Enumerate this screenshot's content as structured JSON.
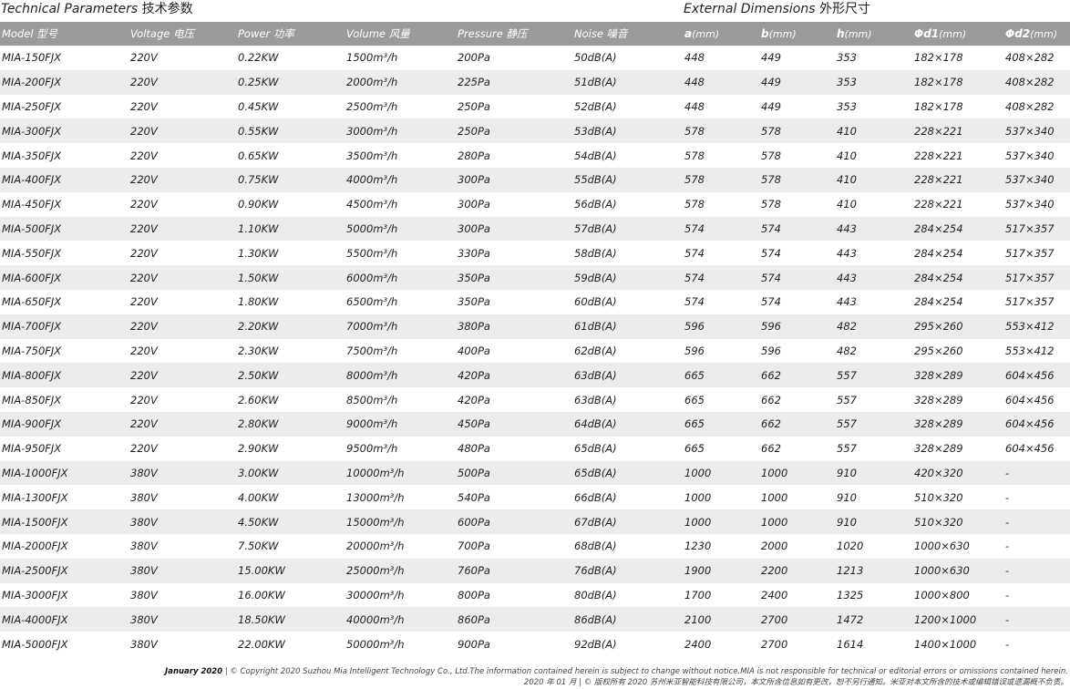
{
  "titles": {
    "technical": "Technical Parameters",
    "technical_cn": "技术参数",
    "external": "External Dimensions",
    "external_cn": "外形尺寸"
  },
  "headers": {
    "model": "Model 型号",
    "voltage": "Voltage 电压",
    "power": "Power 功率",
    "volume": "Volume 风量",
    "pressure": "Pressure 静压",
    "noise": "Noise 噪音",
    "a": "a",
    "a_unit": "(mm)",
    "b": "b",
    "b_unit": "(mm)",
    "h": "h",
    "h_unit": "(mm)",
    "d1": "Φd1",
    "d1_unit": "(mm)",
    "d2": "Φd2",
    "d2_unit": "(mm)"
  },
  "rows": [
    [
      "MIA-150FJX",
      "220V",
      "0.22KW",
      "1500m³/h",
      "200Pa",
      "50dB(A)",
      "448",
      "449",
      "353",
      "182×178",
      "408×282"
    ],
    [
      "MIA-200FJX",
      "220V",
      "0.25KW",
      "2000m³/h",
      "225Pa",
      "51dB(A)",
      "448",
      "449",
      "353",
      "182×178",
      "408×282"
    ],
    [
      "MIA-250FJX",
      "220V",
      "0.45KW",
      "2500m³/h",
      "250Pa",
      "52dB(A)",
      "448",
      "449",
      "353",
      "182×178",
      "408×282"
    ],
    [
      "MIA-300FJX",
      "220V",
      "0.55KW",
      "3000m³/h",
      "250Pa",
      "53dB(A)",
      "578",
      "578",
      "410",
      "228×221",
      "537×340"
    ],
    [
      "MIA-350FJX",
      "220V",
      "0.65KW",
      "3500m³/h",
      "280Pa",
      "54dB(A)",
      "578",
      "578",
      "410",
      "228×221",
      "537×340"
    ],
    [
      "MIA-400FJX",
      "220V",
      "0.75KW",
      "4000m³/h",
      "300Pa",
      "55dB(A)",
      "578",
      "578",
      "410",
      "228×221",
      "537×340"
    ],
    [
      "MIA-450FJX",
      "220V",
      "0.90KW",
      "4500m³/h",
      "300Pa",
      "56dB(A)",
      "578",
      "578",
      "410",
      "228×221",
      "537×340"
    ],
    [
      "MIA-500FJX",
      "220V",
      "1.10KW",
      "5000m³/h",
      "300Pa",
      "57dB(A)",
      "574",
      "574",
      "443",
      "284×254",
      "517×357"
    ],
    [
      "MIA-550FJX",
      "220V",
      "1.30KW",
      "5500m³/h",
      "330Pa",
      "58dB(A)",
      "574",
      "574",
      "443",
      "284×254",
      "517×357"
    ],
    [
      "MIA-600FJX",
      "220V",
      "1.50KW",
      "6000m³/h",
      "350Pa",
      "59dB(A)",
      "574",
      "574",
      "443",
      "284×254",
      "517×357"
    ],
    [
      "MIA-650FJX",
      "220V",
      "1.80KW",
      "6500m³/h",
      "350Pa",
      "60dB(A)",
      "574",
      "574",
      "443",
      "284×254",
      "517×357"
    ],
    [
      "MIA-700FJX",
      "220V",
      "2.20KW",
      "7000m³/h",
      "380Pa",
      "61dB(A)",
      "596",
      "596",
      "482",
      "295×260",
      "553×412"
    ],
    [
      "MIA-750FJX",
      "220V",
      "2.30KW",
      "7500m³/h",
      "400Pa",
      "62dB(A)",
      "596",
      "596",
      "482",
      "295×260",
      "553×412"
    ],
    [
      "MIA-800FJX",
      "220V",
      "2.50KW",
      "8000m³/h",
      "420Pa",
      "63dB(A)",
      "665",
      "662",
      "557",
      "328×289",
      "604×456"
    ],
    [
      "MIA-850FJX",
      "220V",
      "2.60KW",
      "8500m³/h",
      "420Pa",
      "63dB(A)",
      "665",
      "662",
      "557",
      "328×289",
      "604×456"
    ],
    [
      "MIA-900FJX",
      "220V",
      "2.80KW",
      "9000m³/h",
      "450Pa",
      "64dB(A)",
      "665",
      "662",
      "557",
      "328×289",
      "604×456"
    ],
    [
      "MIA-950FJX",
      "220V",
      "2.90KW",
      "9500m³/h",
      "480Pa",
      "65dB(A)",
      "665",
      "662",
      "557",
      "328×289",
      "604×456"
    ],
    [
      "MIA-1000FJX",
      "380V",
      "3.00KW",
      "10000m³/h",
      "500Pa",
      "65dB(A)",
      "1000",
      "1000",
      "910",
      "420×320",
      "-"
    ],
    [
      "MIA-1300FJX",
      "380V",
      "4.00KW",
      "13000m³/h",
      "540Pa",
      "66dB(A)",
      "1000",
      "1000",
      "910",
      "510×320",
      "-"
    ],
    [
      "MIA-1500FJX",
      "380V",
      "4.50KW",
      "15000m³/h",
      "600Pa",
      "67dB(A)",
      "1000",
      "1000",
      "910",
      "510×320",
      "-"
    ],
    [
      "MIA-2000FJX",
      "380V",
      "7.50KW",
      "20000m³/h",
      "700Pa",
      "68dB(A)",
      "1230",
      "2000",
      "1020",
      "1000×630",
      "-"
    ],
    [
      "MIA-2500FJX",
      "380V",
      "15.00KW",
      "25000m³/h",
      "760Pa",
      "76dB(A)",
      "1900",
      "2200",
      "1213",
      "1000×630",
      "-"
    ],
    [
      "MIA-3000FJX",
      "380V",
      "16.00KW",
      "30000m³/h",
      "800Pa",
      "80dB(A)",
      "1700",
      "2400",
      "1325",
      "1000×800",
      "-"
    ],
    [
      "MIA-4000FJX",
      "380V",
      "18.50KW",
      "40000m³/h",
      "860Pa",
      "86dB(A)",
      "2100",
      "2700",
      "1472",
      "1200×1000",
      "-"
    ],
    [
      "MIA-5000FJX",
      "380V",
      "22.00KW",
      "50000m³/h",
      "900Pa",
      "92dB(A)",
      "2400",
      "2700",
      "1614",
      "1400×1000",
      "-"
    ]
  ],
  "footer": {
    "date": "January 2020",
    "line1": " | © Copyright 2020 Suzhou Mia Intelligent Technology Co., Ltd.The information contained herein is subject to change without notice.MIA is not responsible for technical or editorial errors or omissions contained herein.",
    "line2": "2020 年 01 月 | © 版权所有 2020 苏州米亚智能科技有限公司，本文所含信息如有更改，恕不另行通知。米亚对本文所含的技术或编辑错误或遗漏概不负责。"
  }
}
